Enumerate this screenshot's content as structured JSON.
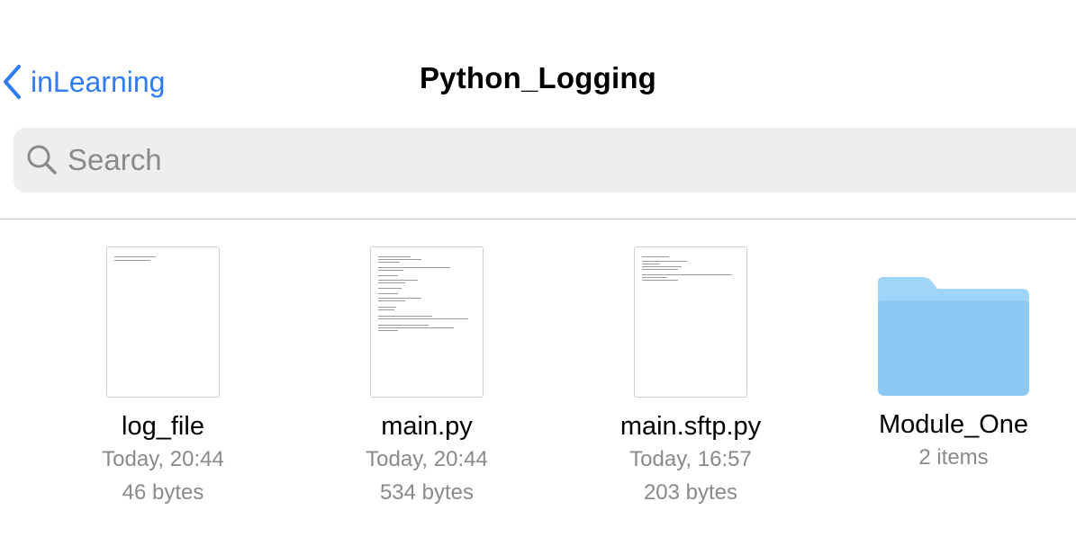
{
  "nav": {
    "back_label": "inLearning",
    "title": "Python_Logging"
  },
  "search": {
    "placeholder": "Search"
  },
  "colors": {
    "accent": "#2f7cf6",
    "folder": "#8fccf5",
    "secondary_text": "#8a8a8e"
  },
  "files": [
    {
      "name": "log_file",
      "date": "Today, 20:44",
      "size": "46 bytes",
      "kind": "document"
    },
    {
      "name": "main.py",
      "date": "Today, 20:44",
      "size": "534 bytes",
      "kind": "document"
    },
    {
      "name": "main.sftp.py",
      "date": "Today, 16:57",
      "size": "203 bytes",
      "kind": "document"
    },
    {
      "name": "Module_One",
      "items": "2 items",
      "kind": "folder"
    }
  ]
}
